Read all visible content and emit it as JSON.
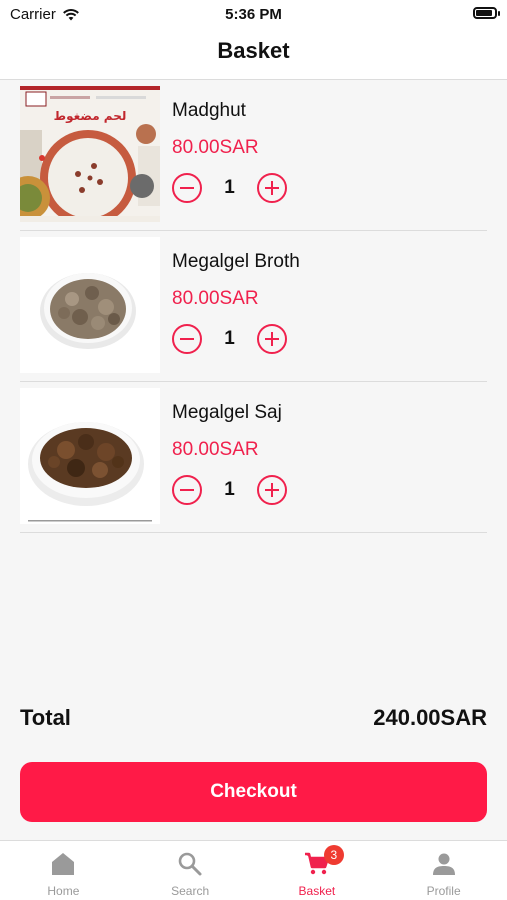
{
  "status_bar": {
    "carrier": "Carrier",
    "time": "5:36 PM"
  },
  "header": {
    "title": "Basket"
  },
  "items": [
    {
      "name": "Madghut",
      "price": "80.00SAR",
      "quantity": "1",
      "image_text": "لحم مضغوط"
    },
    {
      "name": "Megalgel Broth",
      "price": "80.00SAR",
      "quantity": "1"
    },
    {
      "name": "Megalgel Saj",
      "price": "80.00SAR",
      "quantity": "1"
    }
  ],
  "summary": {
    "total_label": "Total",
    "total_value": "240.00SAR"
  },
  "checkout": {
    "label": "Checkout"
  },
  "tabbar": {
    "tabs": [
      {
        "label": "Home",
        "icon": "home-icon"
      },
      {
        "label": "Search",
        "icon": "search-icon"
      },
      {
        "label": "Basket",
        "icon": "cart-icon",
        "badge": "3",
        "active": true
      },
      {
        "label": "Profile",
        "icon": "profile-icon"
      }
    ]
  },
  "colors": {
    "accent": "#f0214d",
    "button": "#ff1a47",
    "badge": "#ef3b31",
    "inactive": "#9a9a9a"
  }
}
